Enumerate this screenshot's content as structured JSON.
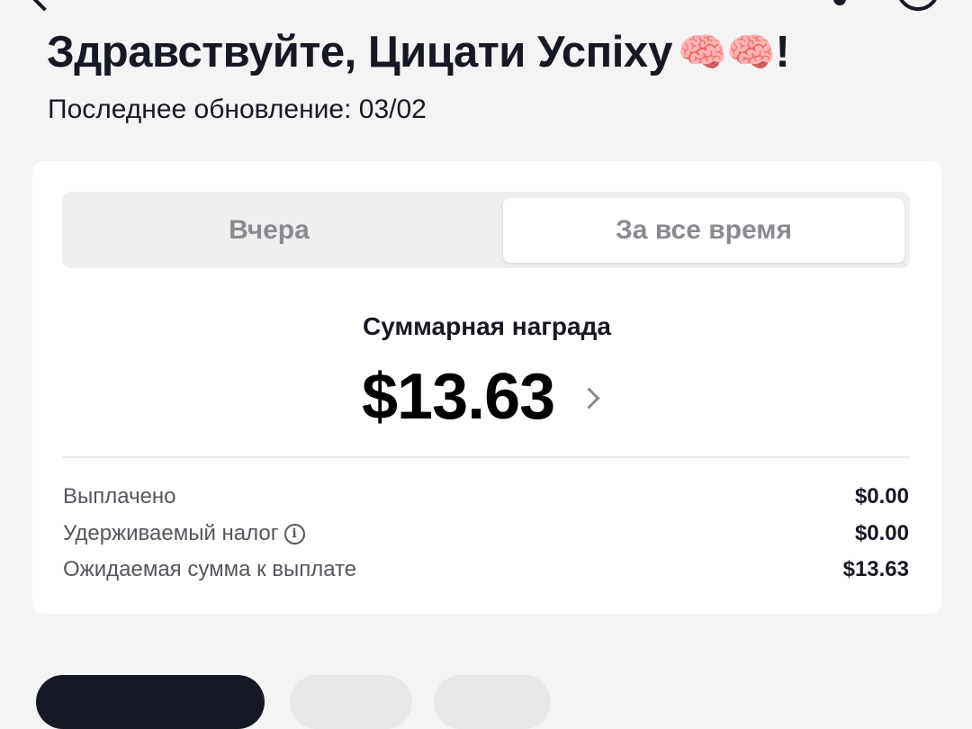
{
  "header": {
    "greeting": "Здравствуйте, Цицати Успіху",
    "greeting_emoji": "🧠🧠",
    "greeting_suffix": "!",
    "last_update": "Последнее обновление: 03/02"
  },
  "tabs": [
    {
      "label": "Вчера",
      "selected": false
    },
    {
      "label": "За все время",
      "selected": true
    }
  ],
  "summary": {
    "total_label": "Суммарная награда",
    "total_amount": "$13.63"
  },
  "breakdown": [
    {
      "label": "Выплачено",
      "value": "$0.00"
    },
    {
      "label": "Удерживаемый налог",
      "value": "$0.00",
      "icon": "info-icon"
    },
    {
      "label": "Ожидаемая сумма к выплате",
      "value": "$13.63"
    }
  ],
  "icons": {
    "info": "ⓘ"
  },
  "colors": {
    "background": "#f4f4f4",
    "card": "#ffffff",
    "text_primary": "#161823",
    "text_secondary": "#55565c",
    "tab_inactive": "#8a8b91"
  }
}
